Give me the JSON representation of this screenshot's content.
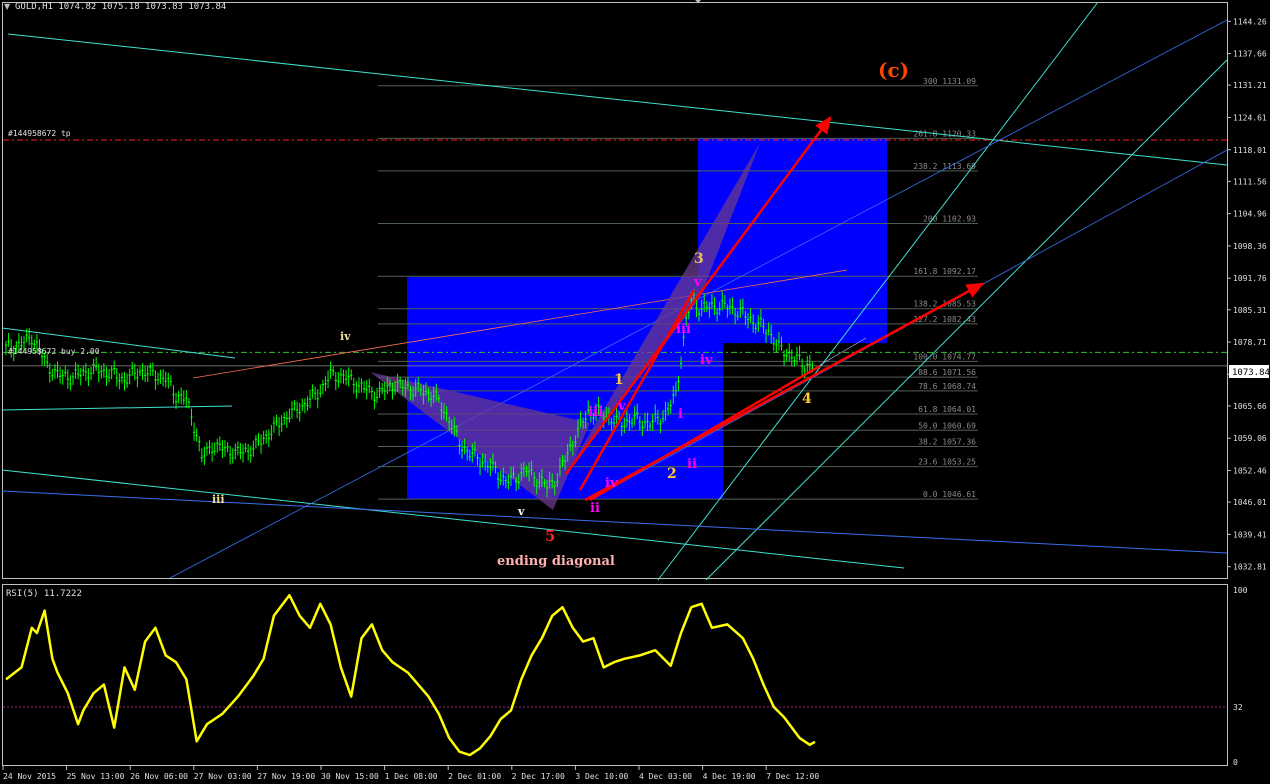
{
  "colors": {
    "background": "#000000",
    "grid_frame": "#c0c0c0",
    "price_bar": "#00ff00",
    "blue_box": "#0000ff",
    "fib_line": "#506050",
    "cyan_channel": "#40e0d0",
    "blue_trend": "#3a6df0",
    "red_arrow": "#ff0000",
    "rsi_line": "#ffff00",
    "rsi_level": "#a0207a",
    "purple_pattern": "#6a3a8a"
  },
  "header": {
    "title": "GOLD,H1  1074.82 1075.18 1073.83 1073.84"
  },
  "trade_labels": {
    "tp": "#144958672 tp",
    "buy": "#144958672 buy 2.00"
  },
  "current_price": "1073.84",
  "chart_data": [
    {
      "type": "candlestick",
      "symbol": "GOLD",
      "timeframe": "H1",
      "ohlc_last": {
        "open": 1074.82,
        "high": 1075.18,
        "low": 1073.83,
        "close": 1073.84
      },
      "price_axis_ticks": [
        "1144.26",
        "1137.66",
        "1131.21",
        "1124.61",
        "1118.01",
        "1111.56",
        "1104.96",
        "1098.36",
        "1091.76",
        "1085.31",
        "1078.71",
        "1072.11",
        "1065.66",
        "1059.06",
        "1052.46",
        "1046.01",
        "1039.41",
        "1032.81"
      ],
      "ylim": [
        1030.5,
        1148.0
      ],
      "time_axis_ticks": [
        "24 Nov 2015",
        "25 Nov 13:00",
        "26 Nov 06:00",
        "27 Nov 03:00",
        "27 Nov 19:00",
        "30 Nov 15:00",
        "1 Dec 08:00",
        "2 Dec 01:00",
        "2 Dec 17:00",
        "3 Dec 10:00",
        "4 Dec 03:00",
        "4 Dec 19:00",
        "7 Dec 12:00"
      ],
      "close_path": [
        [
          0,
          1077.5
        ],
        [
          6,
          1078.2
        ],
        [
          10,
          1079.8
        ],
        [
          12,
          1078.0
        ],
        [
          16,
          1074.0
        ],
        [
          20,
          1072.0
        ],
        [
          26,
          1071.5
        ],
        [
          30,
          1072.5
        ],
        [
          36,
          1073.0
        ],
        [
          42,
          1072.0
        ],
        [
          46,
          1071.0
        ],
        [
          52,
          1072.8
        ],
        [
          58,
          1072.0
        ],
        [
          62,
          1071.2
        ],
        [
          66,
          1067.8
        ],
        [
          70,
          1067.0
        ],
        [
          74,
          1060.0
        ],
        [
          76,
          1055.0
        ],
        [
          80,
          1057.5
        ],
        [
          84,
          1057.0
        ],
        [
          90,
          1056.0
        ],
        [
          96,
          1057.0
        ],
        [
          104,
          1061.0
        ],
        [
          110,
          1064.0
        ],
        [
          116,
          1066.0
        ],
        [
          122,
          1068.8
        ],
        [
          126,
          1072.0
        ],
        [
          132,
          1071.5
        ],
        [
          138,
          1069.5
        ],
        [
          144,
          1068.0
        ],
        [
          150,
          1070.0
        ],
        [
          158,
          1069.2
        ],
        [
          166,
          1068.0
        ],
        [
          172,
          1063.0
        ],
        [
          176,
          1058.0
        ],
        [
          180,
          1056.0
        ],
        [
          186,
          1054.0
        ],
        [
          190,
          1052.5
        ],
        [
          194,
          1050.2
        ],
        [
          198,
          1051.0
        ],
        [
          202,
          1052.5
        ],
        [
          206,
          1050.8
        ],
        [
          210,
          1049.2
        ],
        [
          214,
          1051.0
        ],
        [
          218,
          1056.0
        ],
        [
          222,
          1060.5
        ],
        [
          226,
          1064.5
        ],
        [
          232,
          1064.0
        ],
        [
          238,
          1062.0
        ],
        [
          244,
          1063.0
        ],
        [
          250,
          1062.0
        ],
        [
          256,
          1064.0
        ],
        [
          260,
          1068.0
        ],
        [
          264,
          1083.0
        ],
        [
          266,
          1087.0
        ],
        [
          270,
          1085.5
        ],
        [
          274,
          1086.0
        ],
        [
          280,
          1086.0
        ],
        [
          286,
          1084.5
        ],
        [
          290,
          1083.0
        ],
        [
          296,
          1081.0
        ],
        [
          300,
          1077.5
        ],
        [
          306,
          1075.5
        ],
        [
          310,
          1074.0
        ],
        [
          314,
          1073.84
        ]
      ],
      "fib_levels": [
        {
          "label": "300 1131.09",
          "value": 1131.09
        },
        {
          "label": "261.8 1120.33",
          "value": 1120.33
        },
        {
          "label": "238.2 1113.69",
          "value": 1113.69
        },
        {
          "label": "200 1102.93",
          "value": 1102.93
        },
        {
          "label": "161.8 1092.17",
          "value": 1092.17
        },
        {
          "label": "138.2 1085.53",
          "value": 1085.53
        },
        {
          "label": "127.2 1082.43",
          "value": 1082.43
        },
        {
          "label": "100.0 1074.77",
          "value": 1074.77
        },
        {
          "label": "88.6 1071.56",
          "value": 1071.56
        },
        {
          "label": "78.6 1068.74",
          "value": 1068.74
        },
        {
          "label": "61.8 1064.01",
          "value": 1064.01
        },
        {
          "label": "50.0 1060.69",
          "value": 1060.69
        },
        {
          "label": "38.2 1057.36",
          "value": 1057.36
        },
        {
          "label": "23.6 1053.25",
          "value": 1053.25
        },
        {
          "label": "0.0 1046.61",
          "value": 1046.61
        }
      ],
      "wave_labels": [
        {
          "text": "(c)",
          "color": "#ff4500"
        },
        {
          "text": "3",
          "color": "#e8c060"
        },
        {
          "text": "v",
          "color": "#ff00ff"
        },
        {
          "text": "iii",
          "color": "#ff00ff"
        },
        {
          "text": "iv",
          "color": "#ff00ff"
        },
        {
          "text": "1",
          "color": "#ffcc33"
        },
        {
          "text": "iii",
          "color": "#ff00ff"
        },
        {
          "text": "v",
          "color": "#ff00ff"
        },
        {
          "text": "i",
          "color": "#ff00ff"
        },
        {
          "text": "2",
          "color": "#ffcc33"
        },
        {
          "text": "ii",
          "color": "#ff00ff"
        },
        {
          "text": "iv",
          "color": "#ff00ff"
        },
        {
          "text": "ii",
          "color": "#ff00ff"
        },
        {
          "text": "4",
          "color": "#ffcc33"
        },
        {
          "text": "iv",
          "color": "#f0e0a0"
        },
        {
          "text": "iii",
          "color": "#f0e0a0"
        },
        {
          "text": "v",
          "color": "#ffffff"
        },
        {
          "text": "5",
          "color": "#ff2020"
        },
        {
          "text": "ending diagonal",
          "color": "#ffb0b0"
        }
      ]
    },
    {
      "type": "line",
      "title": "RSI(5) 11.7222",
      "ylim": [
        0,
        100
      ],
      "ticks": [
        "100",
        "32",
        "0"
      ],
      "level": 32,
      "values": [
        [
          0,
          48
        ],
        [
          6,
          55
        ],
        [
          10,
          78
        ],
        [
          12,
          75
        ],
        [
          15,
          88
        ],
        [
          18,
          60
        ],
        [
          20,
          52
        ],
        [
          24,
          40
        ],
        [
          28,
          22
        ],
        [
          30,
          30
        ],
        [
          34,
          40
        ],
        [
          38,
          45
        ],
        [
          42,
          20
        ],
        [
          46,
          55
        ],
        [
          50,
          42
        ],
        [
          54,
          70
        ],
        [
          58,
          78
        ],
        [
          62,
          62
        ],
        [
          66,
          58
        ],
        [
          70,
          48
        ],
        [
          74,
          12
        ],
        [
          78,
          22
        ],
        [
          84,
          28
        ],
        [
          90,
          38
        ],
        [
          96,
          50
        ],
        [
          100,
          60
        ],
        [
          104,
          85
        ],
        [
          110,
          97
        ],
        [
          114,
          85
        ],
        [
          118,
          78
        ],
        [
          122,
          92
        ],
        [
          126,
          80
        ],
        [
          130,
          55
        ],
        [
          134,
          38
        ],
        [
          138,
          72
        ],
        [
          142,
          80
        ],
        [
          146,
          65
        ],
        [
          150,
          58
        ],
        [
          156,
          52
        ],
        [
          160,
          45
        ],
        [
          164,
          38
        ],
        [
          168,
          28
        ],
        [
          172,
          14
        ],
        [
          176,
          6
        ],
        [
          180,
          4
        ],
        [
          184,
          8
        ],
        [
          188,
          15
        ],
        [
          192,
          25
        ],
        [
          196,
          30
        ],
        [
          200,
          48
        ],
        [
          204,
          62
        ],
        [
          208,
          72
        ],
        [
          212,
          85
        ],
        [
          216,
          90
        ],
        [
          220,
          78
        ],
        [
          224,
          70
        ],
        [
          228,
          72
        ],
        [
          232,
          55
        ],
        [
          236,
          58
        ],
        [
          240,
          60
        ],
        [
          246,
          62
        ],
        [
          252,
          65
        ],
        [
          258,
          56
        ],
        [
          262,
          75
        ],
        [
          266,
          90
        ],
        [
          270,
          92
        ],
        [
          274,
          78
        ],
        [
          280,
          80
        ],
        [
          286,
          72
        ],
        [
          290,
          60
        ],
        [
          294,
          45
        ],
        [
          298,
          32
        ],
        [
          302,
          26
        ],
        [
          308,
          14
        ],
        [
          312,
          10
        ],
        [
          314,
          11.72
        ]
      ]
    }
  ]
}
